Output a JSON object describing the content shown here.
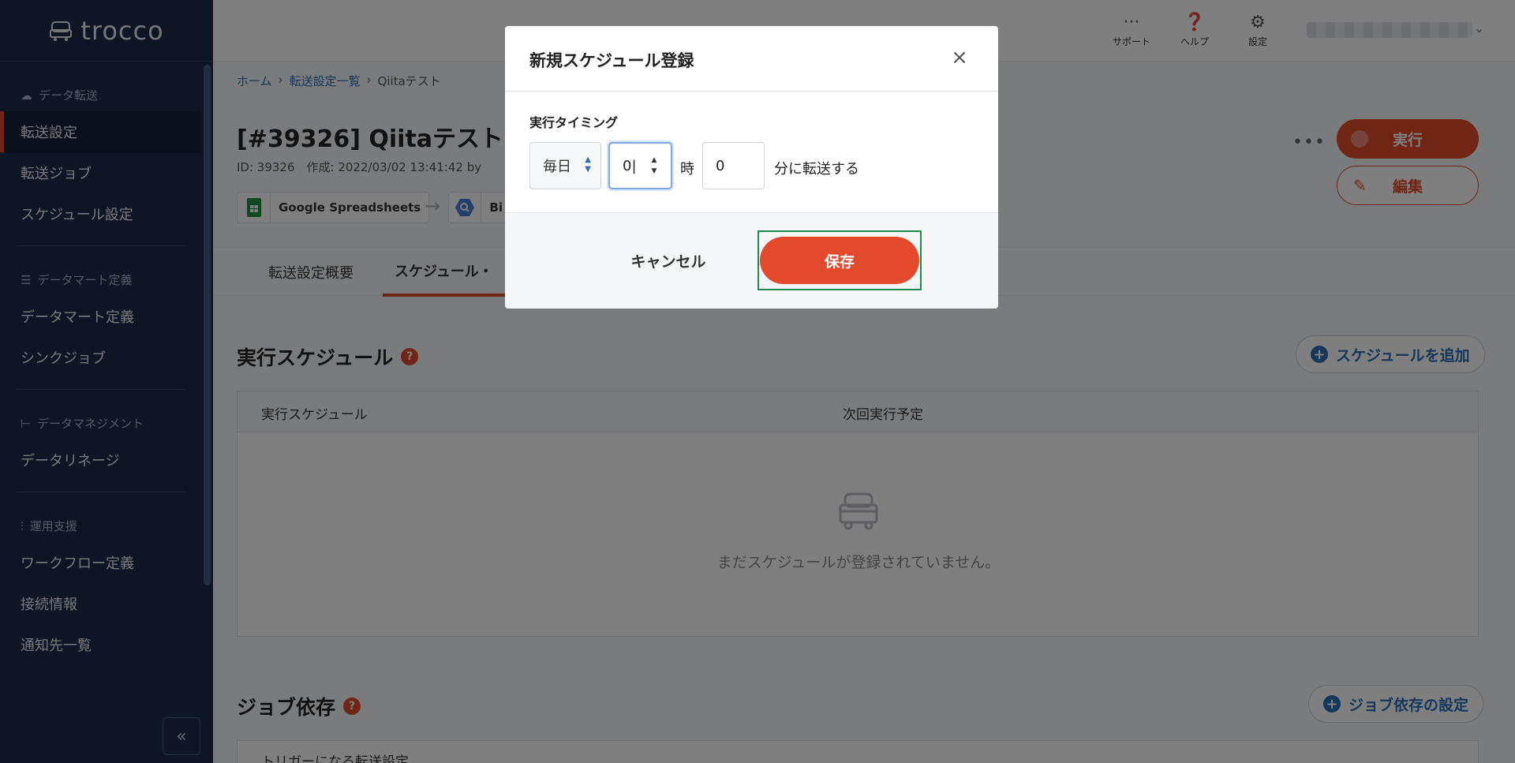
{
  "app": {
    "logo_text": "trocco"
  },
  "sidebar": {
    "sections": [
      {
        "heading": "データ転送",
        "items": [
          "転送設定",
          "転送ジョブ",
          "スケジュール設定"
        ]
      },
      {
        "heading": "データマート定義",
        "items": [
          "データマート定義",
          "シンクジョブ"
        ]
      },
      {
        "heading": "データマネジメント",
        "items": [
          "データリネージ"
        ]
      },
      {
        "heading": "運用支援",
        "items": [
          "ワークフロー定義",
          "接続情報",
          "通知先一覧"
        ]
      }
    ],
    "active_item": "転送設定"
  },
  "topbar": {
    "support": "サポート",
    "help": "ヘルプ",
    "settings": "設定"
  },
  "breadcrumb": {
    "home": "ホーム",
    "list": "転送設定一覧",
    "current": "Qiitaテスト"
  },
  "page": {
    "title": "[#39326] Qiitaテスト",
    "meta": "ID: 39326　作成: 2022/03/02 13:41:42 by",
    "source": "Google Spreadsheets",
    "destination": "Bi",
    "run_button": "実行",
    "edit_button": "編集",
    "tabs": [
      "転送設定概要",
      "スケジュール・"
    ]
  },
  "schedule_section": {
    "title": "実行スケジュール",
    "add_button": "スケジュールを追加",
    "columns": [
      "実行スケジュール",
      "次回実行予定"
    ],
    "empty_text": "まだスケジュールが登録されていません。"
  },
  "dependency_section": {
    "title": "ジョブ依存",
    "settings_button": "ジョブ依存の設定",
    "column": "トリガーになる転送設定"
  },
  "modal": {
    "title": "新規スケジュール登録",
    "field_label": "実行タイミング",
    "frequency": "毎日",
    "hour_value": "0",
    "hour_unit": "時",
    "minute_value": "0",
    "minute_unit": "分に転送する",
    "cancel": "キャンセル",
    "save": "保存"
  },
  "colors": {
    "accent": "#e34a2b",
    "link": "#2a6fb8",
    "sidebar_bg": "#1c2a4a",
    "highlight_frame": "#1f8a4c"
  }
}
